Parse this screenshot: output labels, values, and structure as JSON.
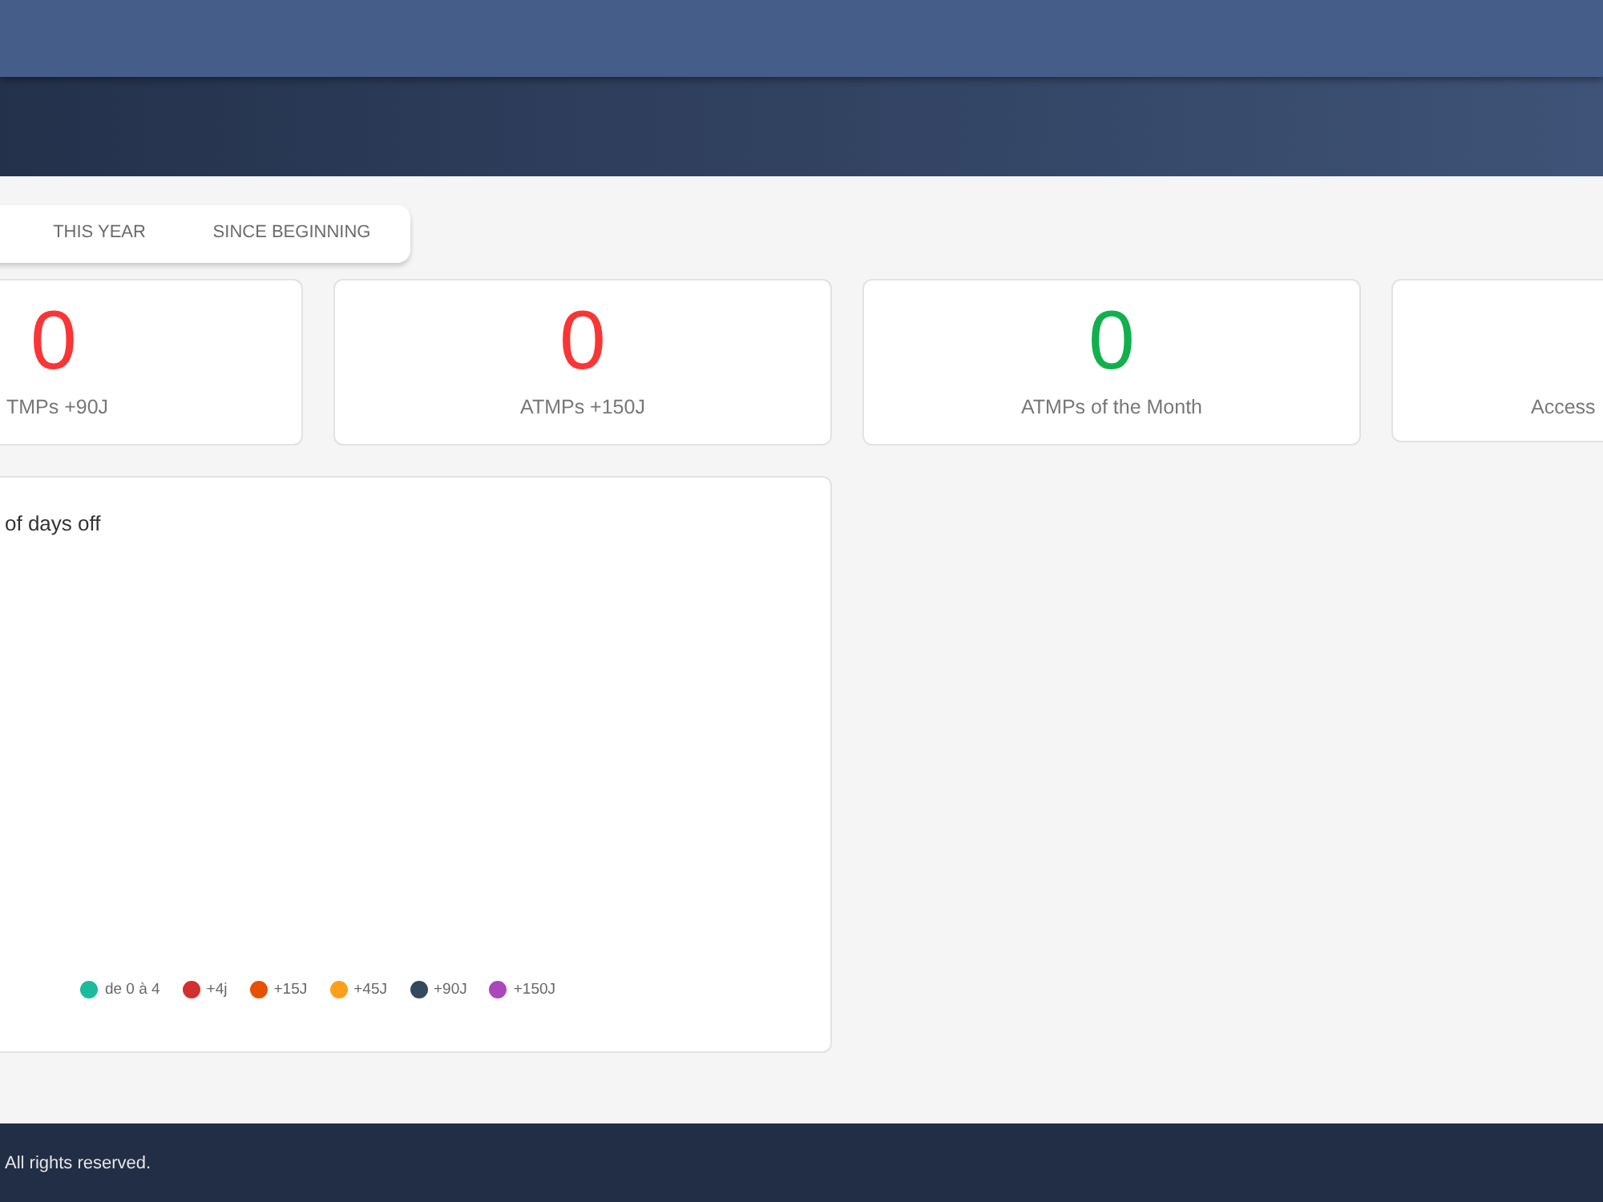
{
  "tabs": [
    {
      "label": "THIS YEAR",
      "selected": false
    },
    {
      "label": "SINCE BEGINNING",
      "selected": false
    }
  ],
  "stat_cards": [
    {
      "value": "0",
      "label": "TMPs +90J",
      "color": "#f93535"
    },
    {
      "value": "0",
      "label": "ATMPs +150J",
      "color": "#f93535"
    },
    {
      "value": "0",
      "label": "ATMPs of the Month",
      "color": "#12b04c"
    },
    {
      "label": "Access"
    }
  ],
  "chart_card": {
    "title": "of days off",
    "legend": [
      {
        "label": "de 0 à 4",
        "color": "#1abc9c"
      },
      {
        "label": "+4j",
        "color": "#d32f2f"
      },
      {
        "label": "+15J",
        "color": "#e65100"
      },
      {
        "label": "+45J",
        "color": "#ff9f1a"
      },
      {
        "label": "+90J",
        "color": "#34495e"
      },
      {
        "label": "+150J",
        "color": "#ab47bc"
      }
    ]
  },
  "footer": {
    "text": "All rights reserved."
  }
}
